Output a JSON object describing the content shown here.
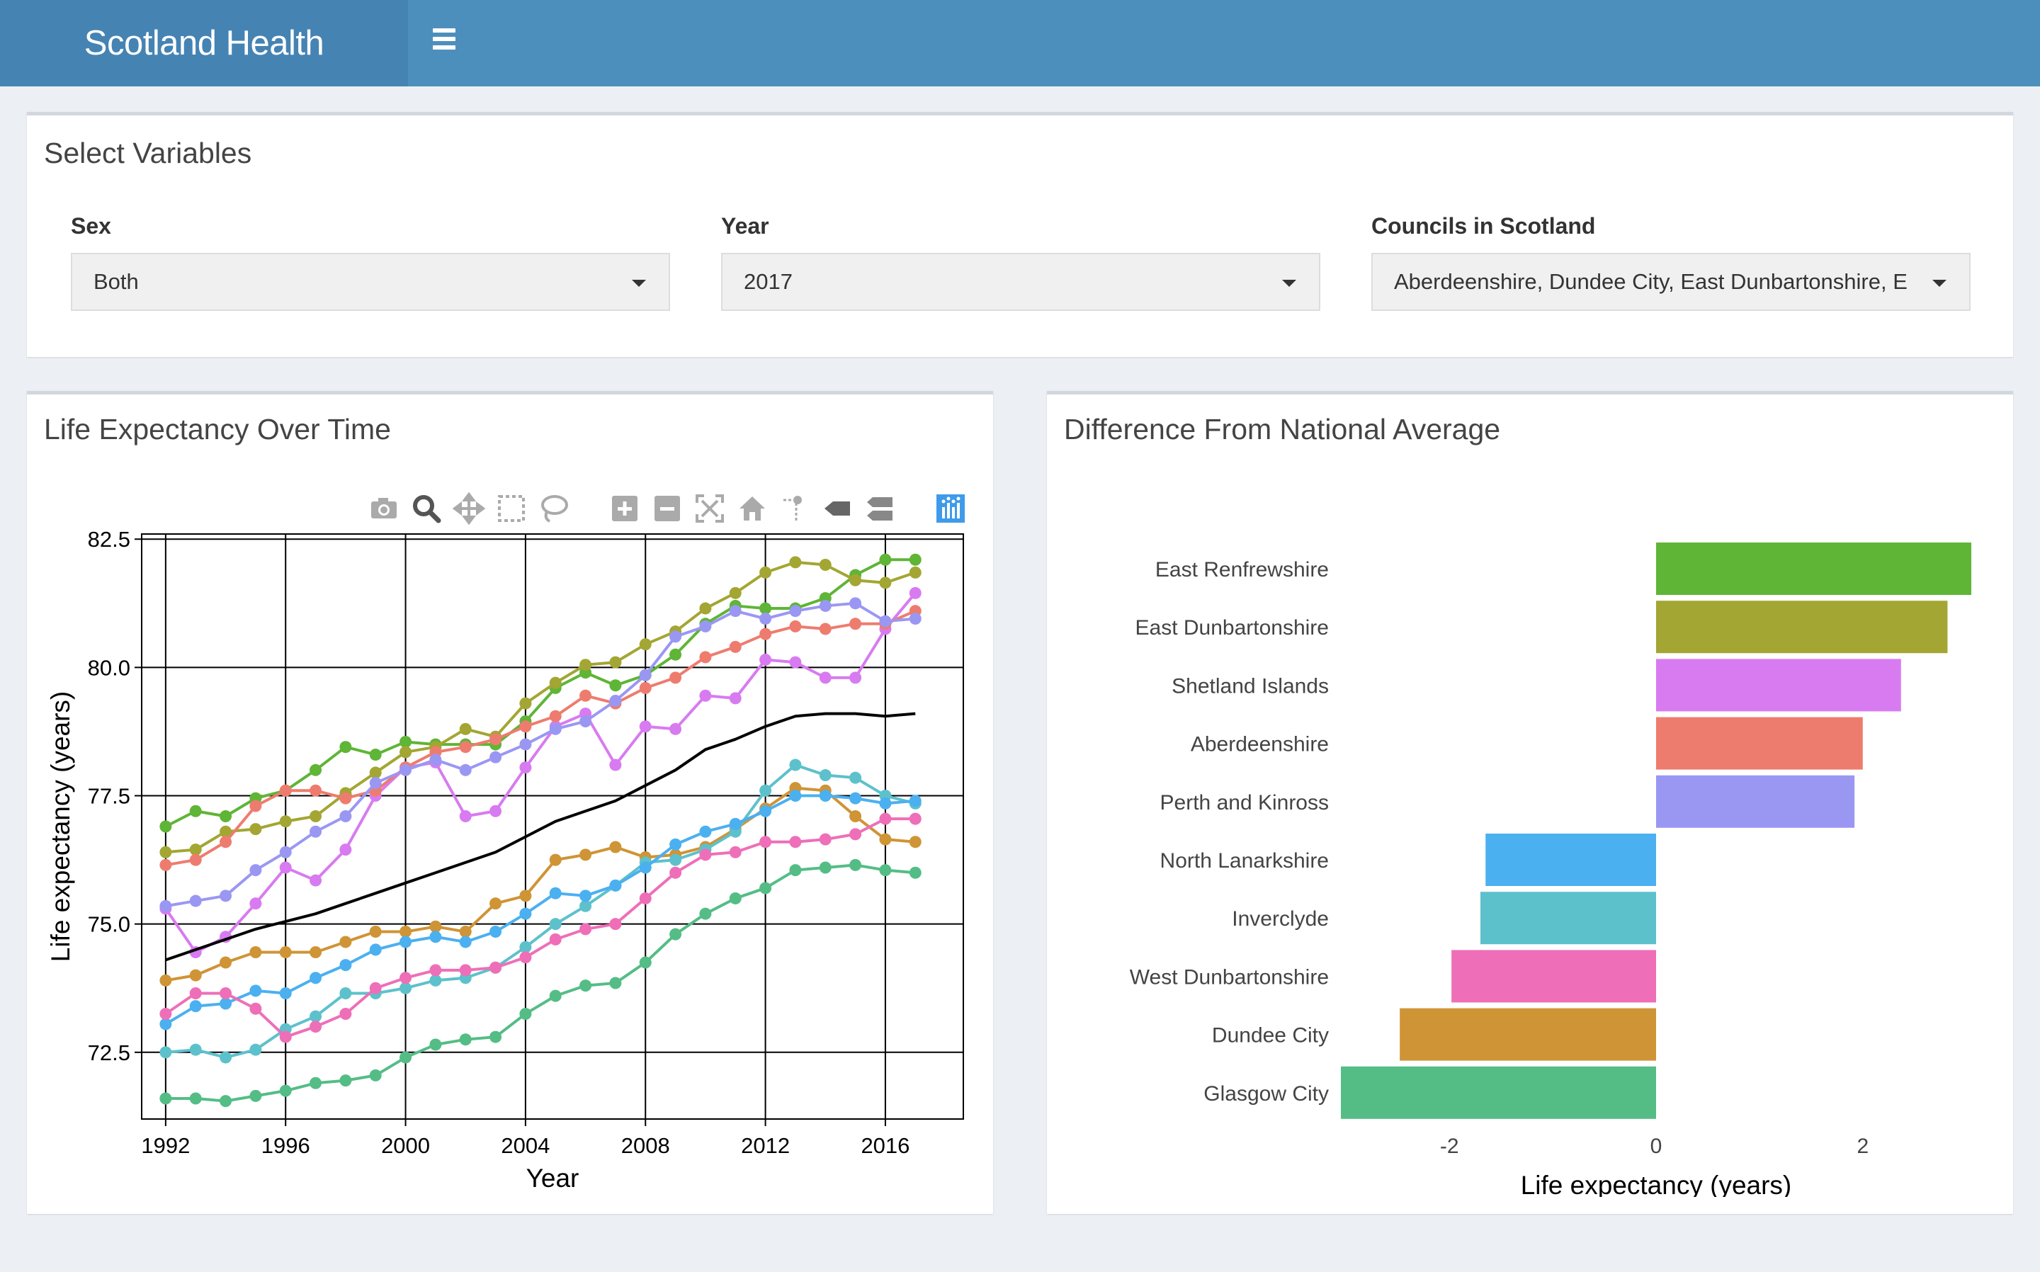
{
  "header": {
    "app_title": "Scotland Health",
    "menu_icon": "hamburger-menu-icon",
    "accent": "#4d8fbc"
  },
  "controls": {
    "panel_title": "Select Variables",
    "sex": {
      "label": "Sex",
      "value": "Both"
    },
    "year": {
      "label": "Year",
      "value": "2017"
    },
    "councils": {
      "label": "Councils in Scotland",
      "value": "Aberdeenshire, Dundee City, East Dunbartonshire, E"
    }
  },
  "left_panel": {
    "title": "Life Expectancy Over Time"
  },
  "right_panel": {
    "title": "Difference From National Average"
  },
  "modebar_icons": [
    "camera-icon",
    "zoom-icon",
    "pan-icon",
    "box-select-icon",
    "lasso-select-icon",
    "zoom-in-icon",
    "zoom-out-icon",
    "autoscale-icon",
    "reset-axes-icon",
    "spike-lines-icon",
    "hover-closest-icon",
    "hover-compare-icon",
    "plotly-logo-icon"
  ],
  "chart_data": [
    {
      "type": "line",
      "title": "",
      "xlabel": "Year",
      "ylabel": "Life expectancy (years)",
      "xlim": [
        1991.2,
        2018.6
      ],
      "ylim": [
        71.2,
        82.6
      ],
      "xticks": [
        1992,
        1996,
        2000,
        2004,
        2008,
        2012,
        2016
      ],
      "yticks": [
        "72.5",
        "75.0",
        "77.5",
        "80.0",
        "82.5"
      ],
      "grid": true,
      "legend": "none",
      "x": [
        1992,
        1993,
        1994,
        1995,
        1996,
        1997,
        1998,
        1999,
        2000,
        2001,
        2002,
        2003,
        2004,
        2005,
        2006,
        2007,
        2008,
        2009,
        2010,
        2011,
        2012,
        2013,
        2014,
        2015,
        2016,
        2017
      ],
      "series": [
        {
          "color": "#5fb536",
          "values": [
            76.9,
            77.2,
            77.1,
            77.45,
            77.6,
            78.0,
            78.45,
            78.3,
            78.55,
            78.5,
            78.5,
            78.5,
            78.95,
            79.6,
            79.9,
            79.65,
            79.85,
            80.25,
            80.85,
            81.2,
            81.15,
            81.15,
            81.35,
            81.8,
            82.1,
            82.1
          ]
        },
        {
          "color": "#a3a632",
          "values": [
            76.4,
            76.45,
            76.8,
            76.85,
            77.0,
            77.1,
            77.55,
            77.95,
            78.35,
            78.45,
            78.8,
            78.65,
            79.3,
            79.7,
            80.05,
            80.1,
            80.45,
            80.7,
            81.15,
            81.45,
            81.85,
            82.05,
            82.0,
            81.7,
            81.65,
            81.85
          ]
        },
        {
          "color": "#d87bf0",
          "values": [
            75.3,
            74.45,
            74.75,
            75.4,
            76.1,
            75.85,
            76.45,
            77.5,
            78.05,
            78.15,
            77.1,
            77.2,
            78.05,
            78.85,
            79.1,
            78.1,
            78.85,
            78.8,
            79.45,
            79.4,
            80.15,
            80.1,
            79.8,
            79.8,
            80.75,
            81.45
          ]
        },
        {
          "color": "#ee7c6e",
          "values": [
            76.15,
            76.25,
            76.6,
            77.3,
            77.6,
            77.6,
            77.45,
            77.6,
            78.05,
            78.35,
            78.45,
            78.6,
            78.85,
            79.05,
            79.45,
            79.3,
            79.6,
            79.8,
            80.2,
            80.4,
            80.65,
            80.8,
            80.75,
            80.85,
            80.85,
            81.1
          ]
        },
        {
          "color": "#9a97f3",
          "values": [
            75.35,
            75.45,
            75.55,
            76.05,
            76.4,
            76.8,
            77.1,
            77.75,
            78.0,
            78.2,
            78.0,
            78.25,
            78.5,
            78.8,
            78.95,
            79.35,
            79.85,
            80.6,
            80.8,
            81.1,
            80.95,
            81.1,
            81.2,
            81.25,
            80.9,
            80.95
          ]
        },
        {
          "color": "#000000",
          "markers": false,
          "values": [
            74.3,
            74.5,
            74.7,
            74.9,
            75.05,
            75.2,
            75.4,
            75.6,
            75.8,
            76.0,
            76.2,
            76.4,
            76.7,
            77.0,
            77.2,
            77.4,
            77.7,
            78.0,
            78.4,
            78.6,
            78.85,
            79.05,
            79.1,
            79.1,
            79.05,
            79.1
          ]
        },
        {
          "color": "#cf9436",
          "values": [
            73.9,
            74.0,
            74.25,
            74.45,
            74.45,
            74.45,
            74.65,
            74.85,
            74.85,
            74.95,
            74.85,
            75.4,
            75.55,
            76.25,
            76.35,
            76.5,
            76.3,
            76.35,
            76.5,
            76.85,
            77.25,
            77.65,
            77.6,
            77.1,
            76.65,
            76.6
          ]
        },
        {
          "color": "#5dc1cc",
          "values": [
            72.5,
            72.55,
            72.4,
            72.55,
            72.95,
            73.2,
            73.65,
            73.65,
            73.75,
            73.9,
            73.95,
            74.15,
            74.55,
            75.0,
            75.35,
            75.75,
            76.2,
            76.25,
            76.45,
            76.8,
            77.6,
            78.1,
            77.9,
            77.85,
            77.5,
            77.35
          ]
        },
        {
          "color": "#4bb0f0",
          "values": [
            73.05,
            73.4,
            73.45,
            73.7,
            73.65,
            73.95,
            74.2,
            74.5,
            74.65,
            74.75,
            74.65,
            74.85,
            75.2,
            75.6,
            75.55,
            75.75,
            76.1,
            76.55,
            76.8,
            76.95,
            77.2,
            77.5,
            77.5,
            77.45,
            77.35,
            77.4
          ]
        },
        {
          "color": "#ee6fb8",
          "values": [
            73.25,
            73.65,
            73.65,
            73.35,
            72.8,
            73.0,
            73.25,
            73.75,
            73.95,
            74.1,
            74.1,
            74.15,
            74.35,
            74.7,
            74.9,
            75.0,
            75.5,
            76.0,
            76.35,
            76.4,
            76.6,
            76.6,
            76.65,
            76.75,
            77.05,
            77.05
          ]
        },
        {
          "color": "#54bd86",
          "values": [
            71.6,
            71.6,
            71.55,
            71.65,
            71.75,
            71.9,
            71.95,
            72.05,
            72.4,
            72.65,
            72.75,
            72.8,
            73.25,
            73.6,
            73.8,
            73.85,
            74.25,
            74.8,
            75.2,
            75.5,
            75.7,
            76.05,
            76.1,
            76.15,
            76.05,
            76.0
          ]
        }
      ]
    },
    {
      "type": "bar",
      "orientation": "horizontal",
      "title": "",
      "xlabel": "Life expectancy (years)",
      "ylabel": "",
      "xlim": [
        -3.05,
        3.05
      ],
      "xticks": [
        "-2",
        "0",
        "2"
      ],
      "categories": [
        "East Renfrewshire",
        "East Dunbartonshire",
        "Shetland Islands",
        "Aberdeenshire",
        "Perth and Kinross",
        "North Lanarkshire",
        "Inverclyde",
        "West Dunbartonshire",
        "Dundee City",
        "Glasgow City"
      ],
      "values": [
        3.05,
        2.82,
        2.37,
        2.0,
        1.92,
        -1.65,
        -1.7,
        -1.98,
        -2.48,
        -3.05
      ],
      "colors": [
        "#5fb536",
        "#a3a632",
        "#d87bf0",
        "#ee7c6e",
        "#9a97f3",
        "#4bb0f0",
        "#5dc1cc",
        "#ee6fb8",
        "#cf9436",
        "#54bd86"
      ]
    }
  ]
}
